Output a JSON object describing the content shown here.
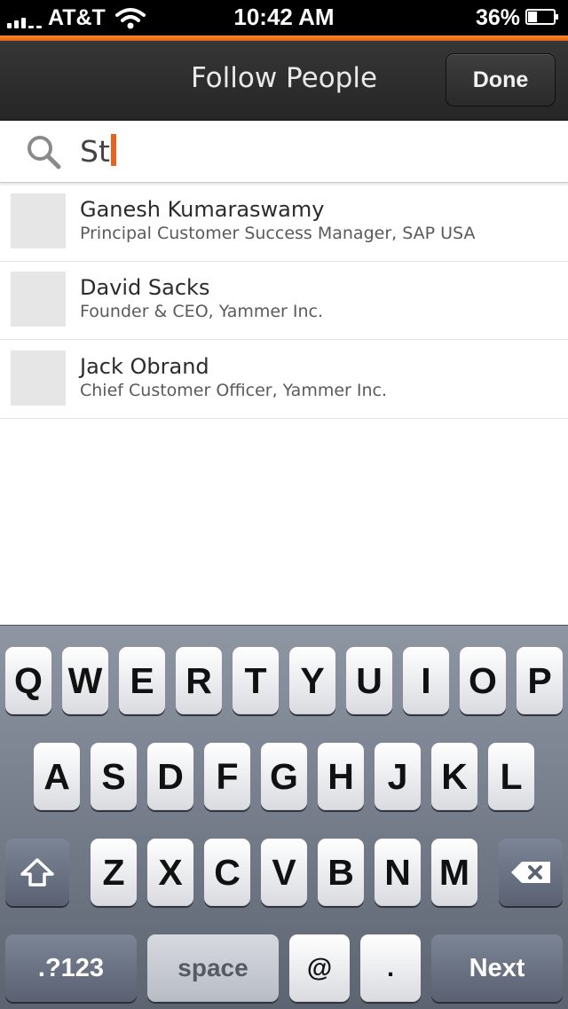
{
  "status_bar": {
    "carrier": "AT&T",
    "time": "10:42 AM",
    "battery_percent": "36%",
    "battery_level": 0.36
  },
  "nav": {
    "title": "Follow People",
    "done_label": "Done"
  },
  "colors": {
    "accent": "#e8641e",
    "nav_background": "#2e2e2e"
  },
  "search": {
    "value": "St",
    "icon": "search-icon"
  },
  "results": [
    {
      "name": "Ganesh Kumaraswamy",
      "subtitle": "Principal Customer Success Manager, SAP USA"
    },
    {
      "name": "David Sacks",
      "subtitle": "Founder & CEO, Yammer Inc."
    },
    {
      "name": "Jack Obrand",
      "subtitle": "Chief Customer Officer, Yammer Inc."
    }
  ],
  "keyboard": {
    "row1": [
      "Q",
      "W",
      "E",
      "R",
      "T",
      "Y",
      "U",
      "I",
      "O",
      "P"
    ],
    "row2": [
      "A",
      "S",
      "D",
      "F",
      "G",
      "H",
      "J",
      "K",
      "L"
    ],
    "row3": [
      "Z",
      "X",
      "C",
      "V",
      "B",
      "N",
      "M"
    ],
    "numbers_label": ".?123",
    "space_label": "space",
    "at_label": "@",
    "dot_label": ".",
    "next_label": "Next",
    "shift_icon": "shift-icon",
    "delete_icon": "delete-icon"
  }
}
